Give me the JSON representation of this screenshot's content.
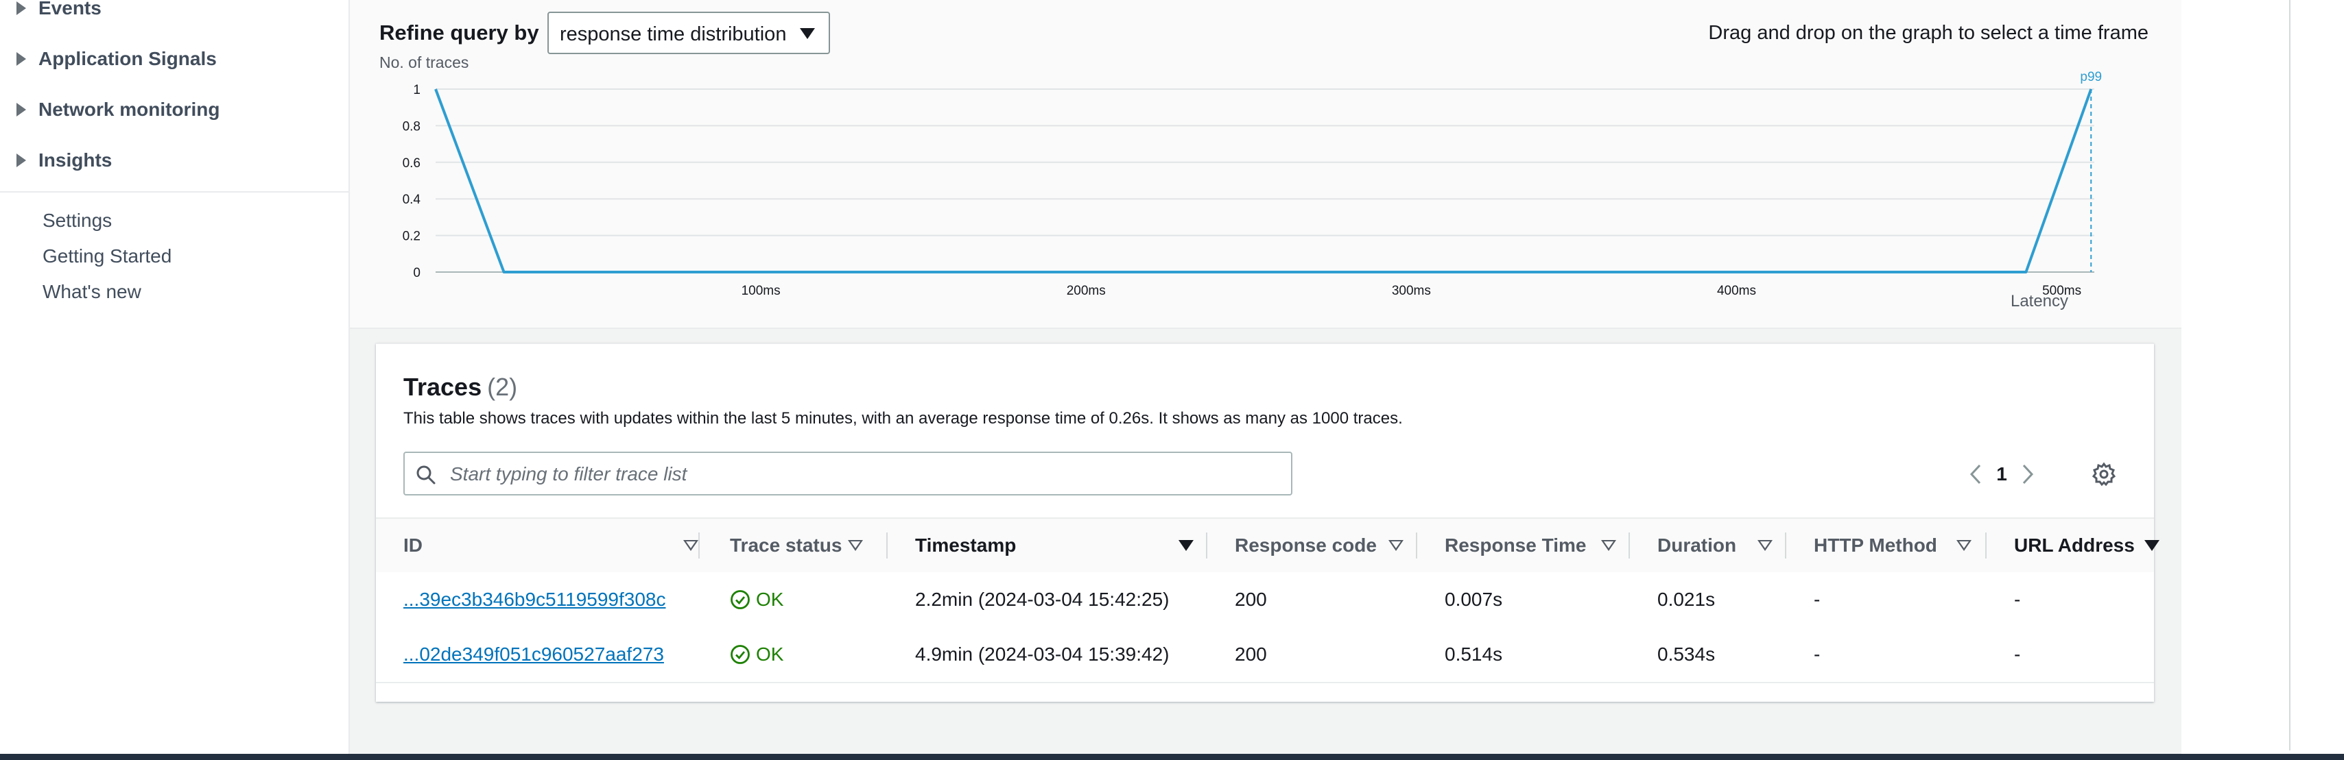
{
  "sidebar": {
    "sections": [
      {
        "label": "Events"
      },
      {
        "label": "Application Signals"
      },
      {
        "label": "Network monitoring"
      },
      {
        "label": "Insights"
      }
    ],
    "links": [
      {
        "label": "Settings"
      },
      {
        "label": "Getting Started"
      },
      {
        "label": "What's new"
      }
    ]
  },
  "chart_panel": {
    "refine_label": "Refine query by",
    "refine_value": "response time distribution",
    "drag_hint": "Drag and drop on the graph to select a time frame",
    "ylabel": "No. of traces",
    "xlabel": "Latency",
    "marker_label": "p99"
  },
  "chart_data": {
    "type": "line",
    "title": "",
    "xlabel": "Latency",
    "ylabel": "No. of traces",
    "x_unit": "ms",
    "xlim": [
      0,
      510
    ],
    "ylim": [
      0,
      1
    ],
    "x_ticks": [
      {
        "value": 100,
        "label": "100ms"
      },
      {
        "value": 200,
        "label": "200ms"
      },
      {
        "value": 300,
        "label": "300ms"
      },
      {
        "value": 400,
        "label": "400ms"
      },
      {
        "value": 500,
        "label": "500ms"
      }
    ],
    "y_ticks": [
      {
        "value": 0,
        "label": "0"
      },
      {
        "value": 0.2,
        "label": "0.2"
      },
      {
        "value": 0.4,
        "label": "0.4"
      },
      {
        "value": 0.6,
        "label": "0.6"
      },
      {
        "value": 0.8,
        "label": "0.8"
      },
      {
        "value": 1,
        "label": "1"
      }
    ],
    "grid": true,
    "series": [
      {
        "color": "#2e9ed1",
        "points": [
          [
            0,
            1
          ],
          [
            21,
            0
          ],
          [
            489,
            0
          ],
          [
            509,
            1
          ]
        ]
      }
    ],
    "markers": [
      {
        "x": 509,
        "label": "p99",
        "style": "dashed-vertical",
        "color": "#2e9ed1"
      }
    ]
  },
  "traces": {
    "title": "Traces",
    "count": "(2)",
    "description": "This table shows traces with updates within the last 5 minutes, with an average response time of 0.26s. It shows as many as 1000 traces.",
    "filter_placeholder": "Start typing to filter trace list",
    "page": "1",
    "columns": [
      {
        "label": "ID",
        "sort": "outline"
      },
      {
        "label": "Trace status",
        "sort": "outline"
      },
      {
        "label": "Timestamp",
        "sort": "filled"
      },
      {
        "label": "Response code",
        "sort": "outline"
      },
      {
        "label": "Response Time",
        "sort": "outline"
      },
      {
        "label": "Duration",
        "sort": "outline"
      },
      {
        "label": "HTTP Method",
        "sort": "outline"
      },
      {
        "label": "URL Address",
        "sort": "filled"
      }
    ],
    "rows": [
      {
        "id": "...39ec3b346b9c5119599f308c",
        "status": "OK",
        "timestamp": "2.2min (2024-03-04 15:42:25)",
        "response_code": "200",
        "response_time": "0.007s",
        "duration": "0.021s",
        "http_method": "-",
        "url": "-"
      },
      {
        "id": "...02de349f051c960527aaf273",
        "status": "OK",
        "timestamp": "4.9min (2024-03-04 15:39:42)",
        "response_code": "200",
        "response_time": "0.514s",
        "duration": "0.534s",
        "http_method": "-",
        "url": "-"
      }
    ]
  },
  "colors": {
    "accent": "#0073bb",
    "series": "#2e9ed1",
    "ok": "#1d8102"
  }
}
